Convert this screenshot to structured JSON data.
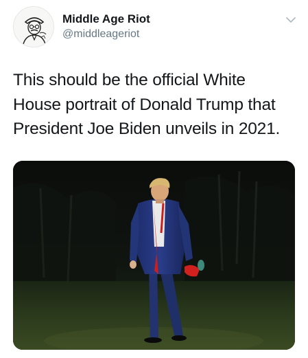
{
  "tweet": {
    "author": {
      "display_name": "Middle Age Riot",
      "handle": "@middleageriot",
      "avatar_icon": "sketch-portrait-avatar"
    },
    "menu_icon": "chevron-down-icon",
    "text_lines": [
      "This should be the official White",
      "House portrait of Donald Trump that",
      "President Joe Biden unveils in 2021."
    ],
    "media": {
      "icon": "photo-of-man-walking-on-lawn-at-night"
    }
  },
  "colors": {
    "text_primary": "#14171a",
    "text_secondary": "#657786",
    "background": "#ffffff"
  }
}
